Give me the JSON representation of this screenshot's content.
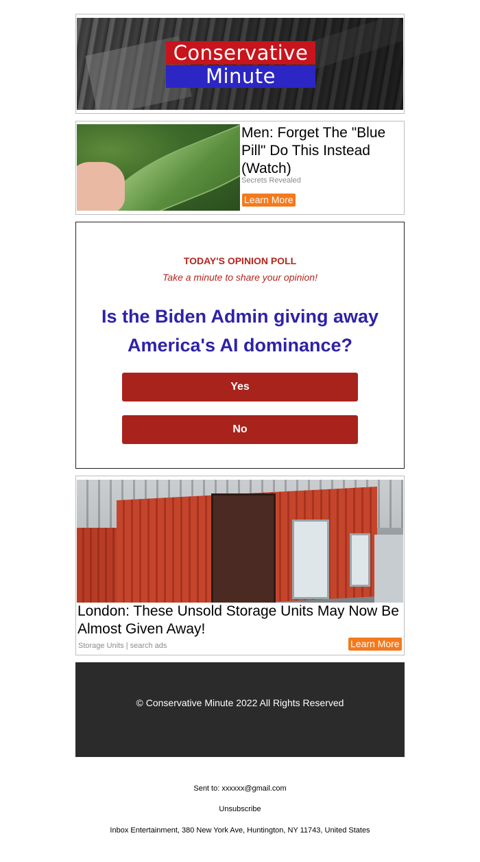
{
  "header": {
    "logo_line1": "Conservative",
    "logo_line2": "Minute",
    "logo_colors": {
      "top": "#c8141c",
      "bottom": "#2c26c4"
    }
  },
  "ad1": {
    "title": "Men: Forget The \"Blue Pill\" Do This Instead (Watch)",
    "source": "Secrets Revealed",
    "cta": "Learn More"
  },
  "poll": {
    "kicker": "TODAY'S OPINION POLL",
    "subtitle": "Take a minute to share your opinion!",
    "question": "Is the Biden Admin giving away America's AI dominance?",
    "options": [
      "Yes",
      "No"
    ],
    "colors": {
      "accent": "#a8231c",
      "question": "#2e22a8"
    }
  },
  "ad2": {
    "title": "London: These Unsold Storage Units May Now Be Almost Given Away!",
    "source": "Storage Units | search ads",
    "cta": "Learn More"
  },
  "footer": {
    "copyright": "© Conservative Minute 2022 All Rights Reserved"
  },
  "email_footer": {
    "sent_to": "Sent to: xxxxxx@gmail.com",
    "unsubscribe": "Unsubscribe",
    "address": "Inbox Entertainment, 380 New York Ave, Huntington, NY 11743, United States"
  }
}
